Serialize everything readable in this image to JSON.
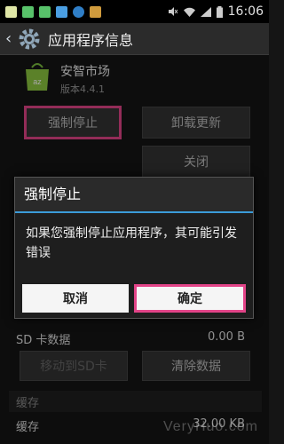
{
  "status_bar": {
    "time": "16:06"
  },
  "action_bar": {
    "title": "应用程序信息"
  },
  "app": {
    "name": "安智市场",
    "version": "版本4.4.1"
  },
  "buttons": {
    "force_stop": "强制停止",
    "uninstall_updates": "卸载更新",
    "close": "关闭",
    "move_to_sd": "移动到SD卡",
    "clear_data": "清除数据"
  },
  "storage": {
    "sd_label": "SD 卡数据",
    "sd_value": "0.00 B"
  },
  "cache": {
    "header": "缓存",
    "label": "缓存",
    "value": "32.00 KB"
  },
  "dialog": {
    "title": "强制停止",
    "message": "如果您强制停止应用程序，其可能引发错误",
    "cancel": "取消",
    "ok": "确定"
  },
  "watermark": "VeryHuo.com",
  "colors": {
    "highlight": "#e24488",
    "accent": "#3b9bd8"
  }
}
